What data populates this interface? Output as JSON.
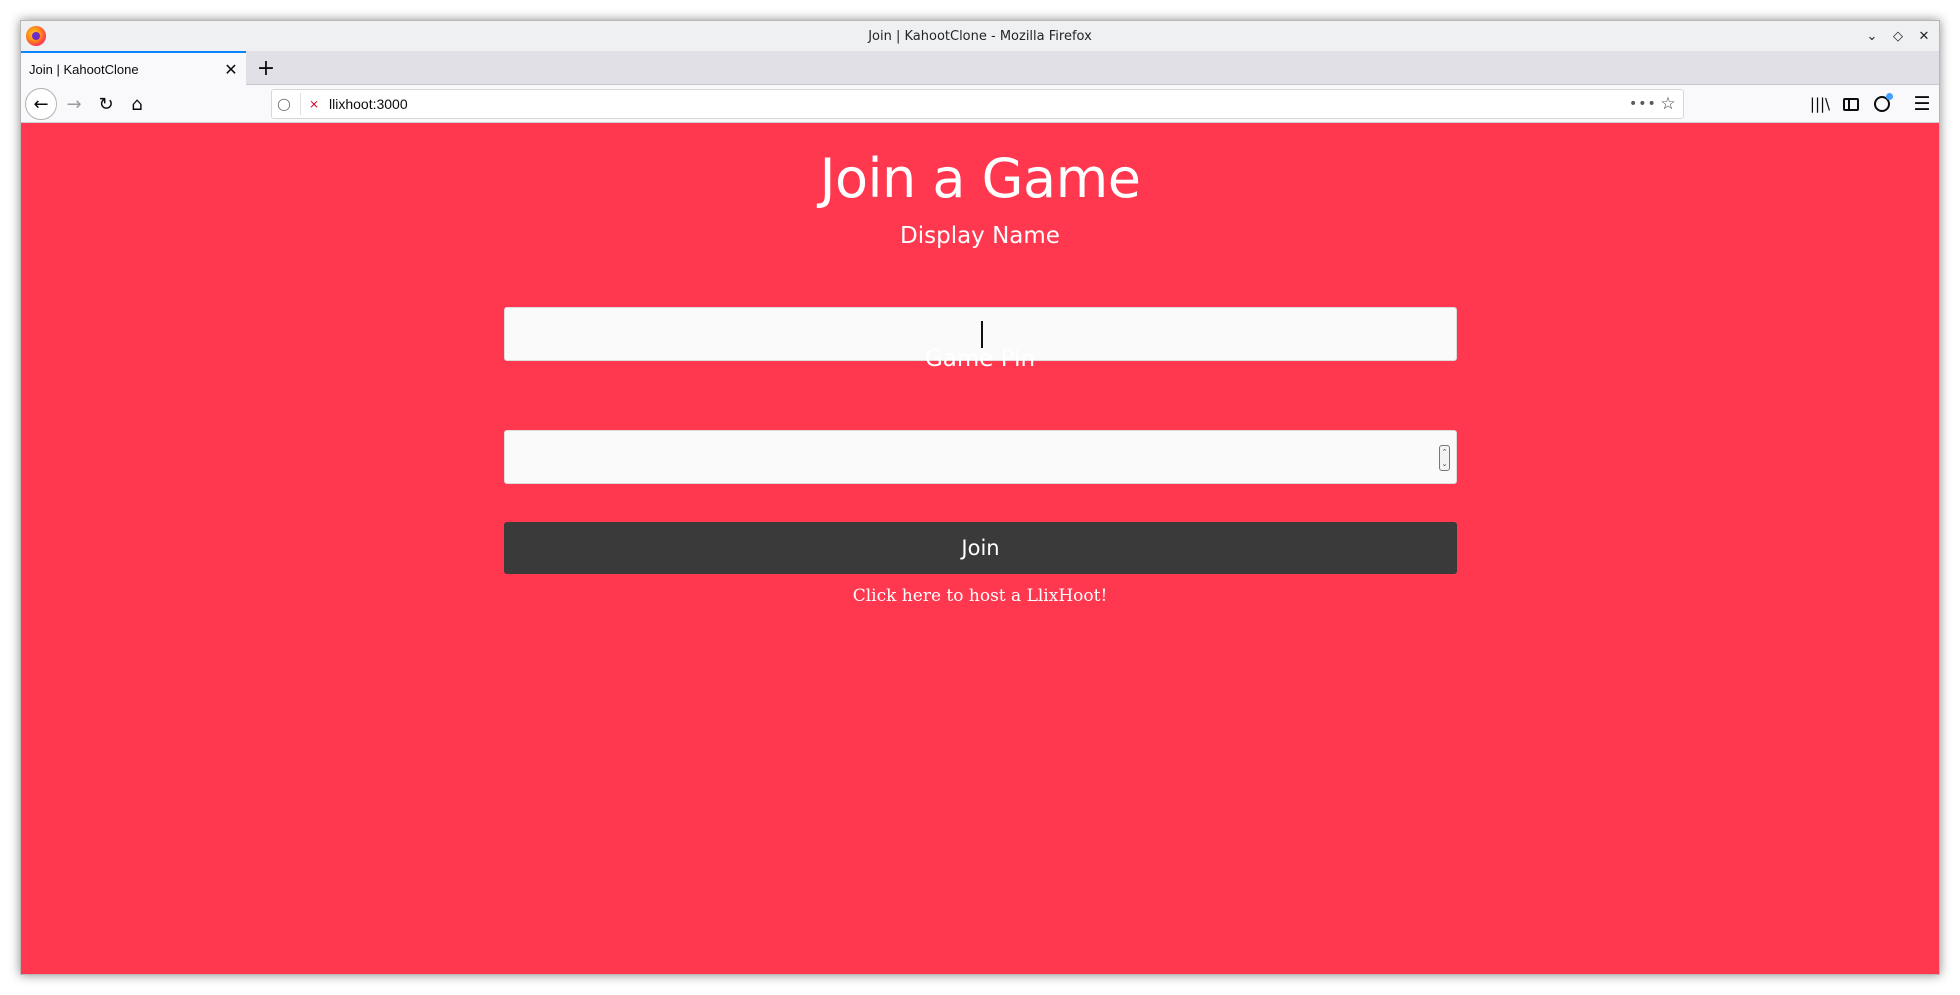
{
  "window": {
    "title": "Join | KahootClone - Mozilla Firefox"
  },
  "tabs": [
    {
      "label": "Join | KahootClone",
      "active": true
    }
  ],
  "new_tab_label": "+",
  "navbar": {
    "url": "llixhoot:3000"
  },
  "page": {
    "heading": "Join a Game",
    "display_name_label": "Display Name",
    "display_name_value": "",
    "game_pin_label": "Game Pin",
    "game_pin_value": "",
    "join_button": "Join",
    "host_link": "Click here to host a LlixHoot!"
  },
  "colors": {
    "background": "#ff3850",
    "button": "#3a3a3a",
    "field": "#fafafa",
    "text": "#ffffff"
  },
  "icons": [
    "firefox-logo",
    "minimize-icon",
    "maximize-icon",
    "close-icon",
    "back-icon",
    "forward-icon",
    "reload-icon",
    "home-icon",
    "shield-icon",
    "insecure-icon",
    "page-actions-icon",
    "bookmark-star-icon",
    "library-icon",
    "sidebar-icon",
    "account-icon",
    "menu-icon"
  ]
}
